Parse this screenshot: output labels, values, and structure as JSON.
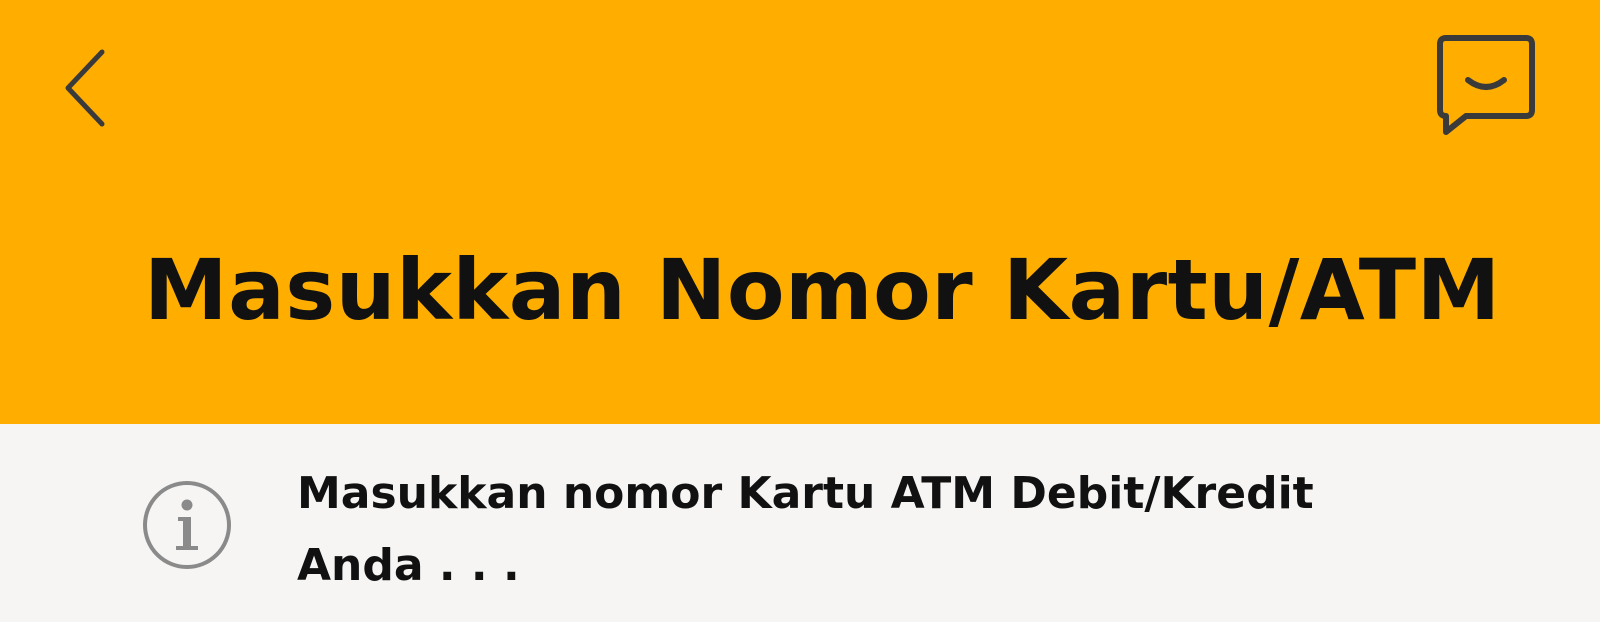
{
  "colors": {
    "header_background": "#ffae00",
    "body_background": "#f6f5f4",
    "text": "#111111",
    "icon_stroke": "#3a3a3a"
  },
  "header": {
    "back_icon": "chevron-left-icon",
    "chat_icon": "smile-chat-bubble-icon",
    "title": "Masukkan Nomor Kartu/ATM"
  },
  "info": {
    "icon": "info-circle-icon",
    "text": "Masukkan nomor Kartu ATM Debit/Kredit Anda . . ."
  }
}
